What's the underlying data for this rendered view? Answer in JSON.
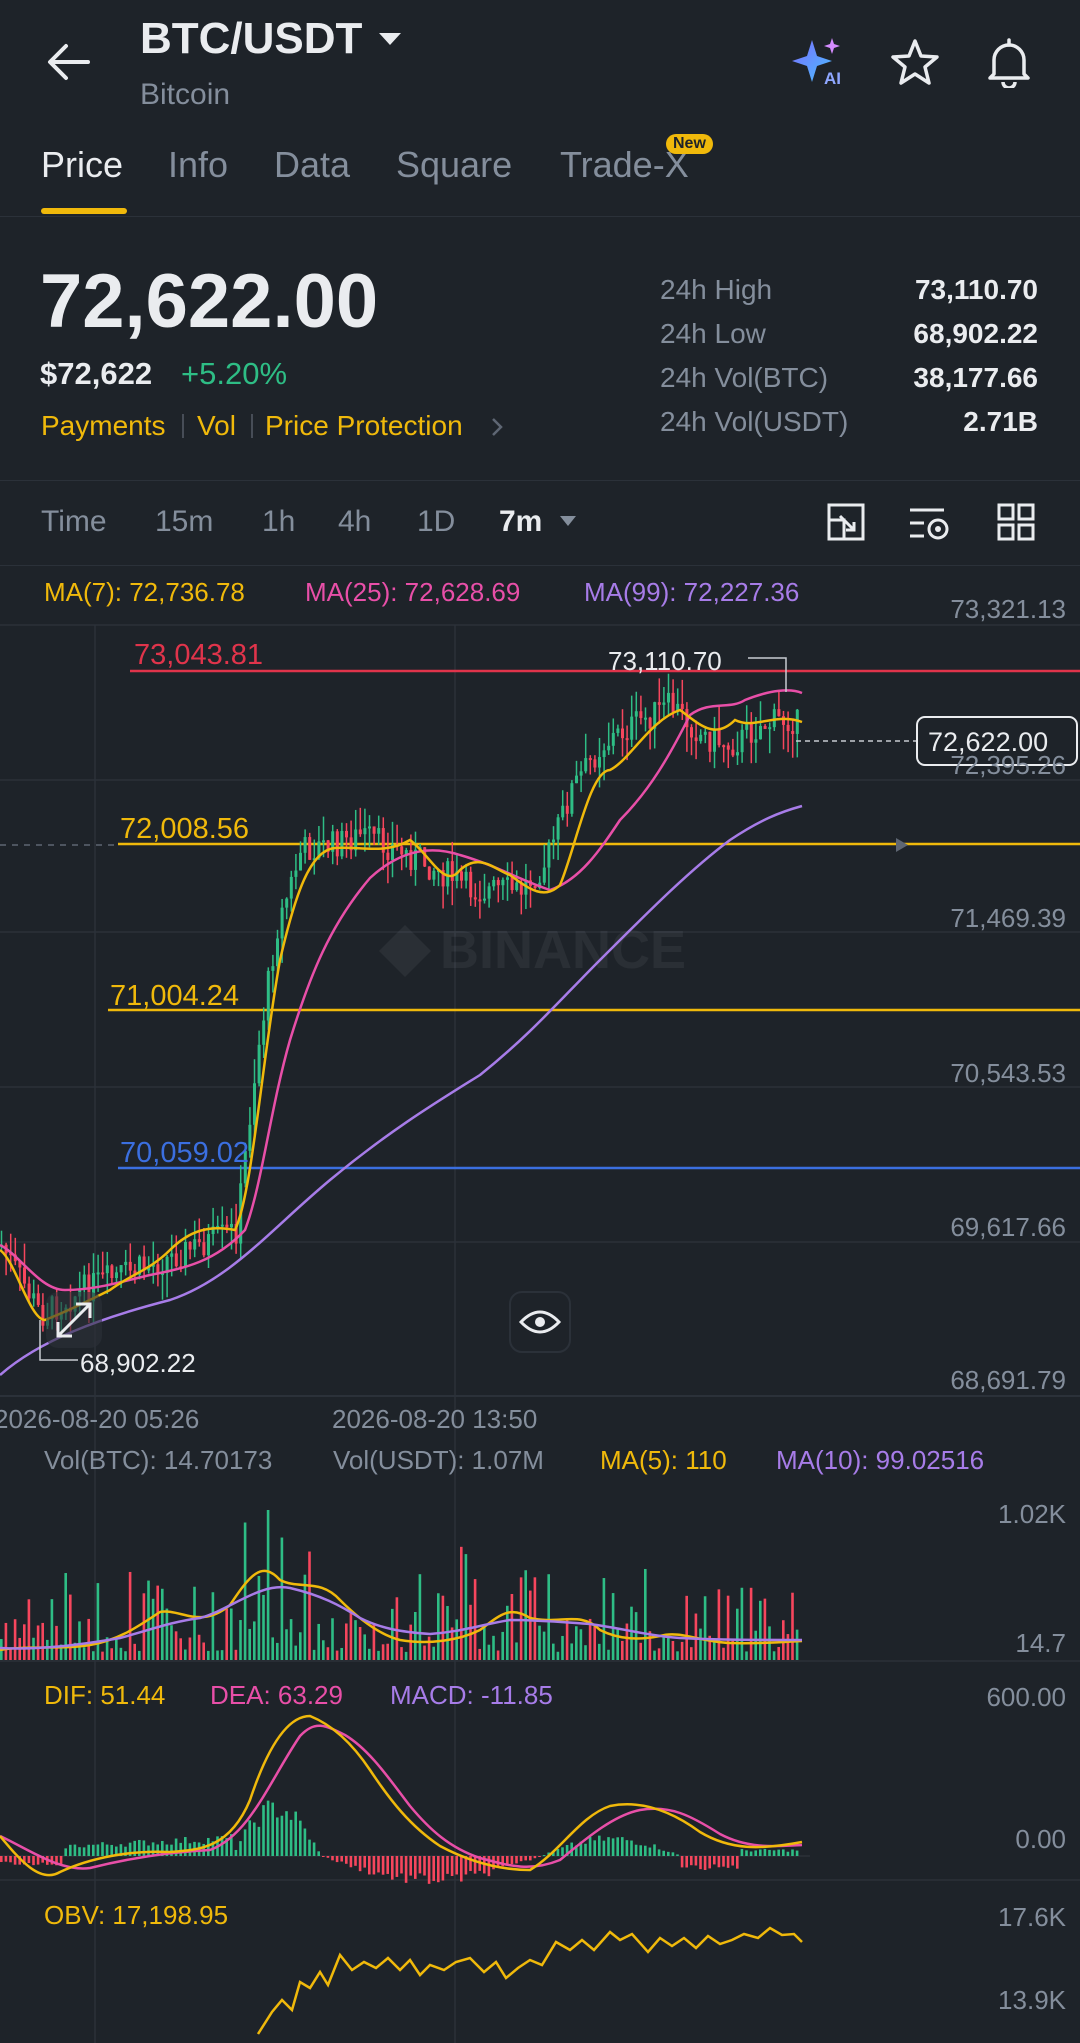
{
  "header": {
    "pair": "BTC/USDT",
    "subtitle": "Bitcoin",
    "icons": [
      "back-arrow-icon",
      "ai-sparkle-icon",
      "star-icon",
      "bell-icon",
      "dropdown-caret-icon"
    ]
  },
  "tabs": [
    {
      "label": "Price",
      "active": true
    },
    {
      "label": "Info",
      "active": false
    },
    {
      "label": "Data",
      "active": false
    },
    {
      "label": "Square",
      "active": false
    },
    {
      "label": "Trade-X",
      "active": false,
      "badge": "New"
    }
  ],
  "ticker": {
    "price": "72,622.00",
    "usd_price": "$72,622",
    "change": "+5.20%",
    "links": [
      "Payments",
      "Vol",
      "Price Protection"
    ],
    "stats": [
      {
        "label": "24h High",
        "value": "73,110.70"
      },
      {
        "label": "24h Low",
        "value": "68,902.22"
      },
      {
        "label": "24h Vol(BTC)",
        "value": "38,177.66"
      },
      {
        "label": "24h Vol(USDT)",
        "value": "2.71B"
      }
    ]
  },
  "timeframes": {
    "items": [
      "Time",
      "15m",
      "1h",
      "4h",
      "1D"
    ],
    "selected": "7m"
  },
  "colors": {
    "background": "#1e2329",
    "up": "#2ebd85",
    "down": "#f6465d",
    "ma7": "#f0b90b",
    "ma25": "#e84fa8",
    "ma99": "#a77ce8",
    "line_red": "#e0344b",
    "line_yellow": "#f0b90b",
    "line_blue": "#3b6fe0"
  },
  "main_chart": {
    "legend": {
      "ma7": "MA(7): 72,736.78",
      "ma25": "MA(25): 72,628.69",
      "ma99": "MA(99): 72,227.36"
    },
    "y_axis": [
      "73,321.13",
      "72,395.26",
      "71,469.39",
      "70,543.53",
      "69,617.66",
      "68,691.79"
    ],
    "current_price": "72,622.00",
    "high_marker": "73,110.70",
    "low_marker": "68,902.22",
    "watermark": "BINANCE",
    "x_labels": [
      "2026-08-20 05:26",
      "2026-08-20 13:50"
    ],
    "lines": [
      {
        "label": "73,043.81",
        "color": "red"
      },
      {
        "label": "72,008.56",
        "color": "yellow"
      },
      {
        "label": "71,004.24",
        "color": "yellow"
      },
      {
        "label": "70,059.02",
        "color": "blue"
      }
    ]
  },
  "volume_chart": {
    "legend": {
      "vol_btc": "Vol(BTC): 14.70173",
      "vol_usdt": "Vol(USDT): 1.07M",
      "ma5": "MA(5): 110",
      "ma10": "MA(10): 99.02516"
    },
    "y_axis": [
      "1.02K",
      "14.7"
    ]
  },
  "macd_chart": {
    "legend": {
      "dif": "DIF: 51.44",
      "dea": "DEA: 63.29",
      "macd": "MACD: -11.85"
    },
    "y_axis": [
      "600.00",
      "0.00"
    ]
  },
  "obv_chart": {
    "legend": {
      "obv": "OBV: 17,198.95"
    },
    "y_axis": [
      "17.6K",
      "13.9K"
    ]
  }
}
